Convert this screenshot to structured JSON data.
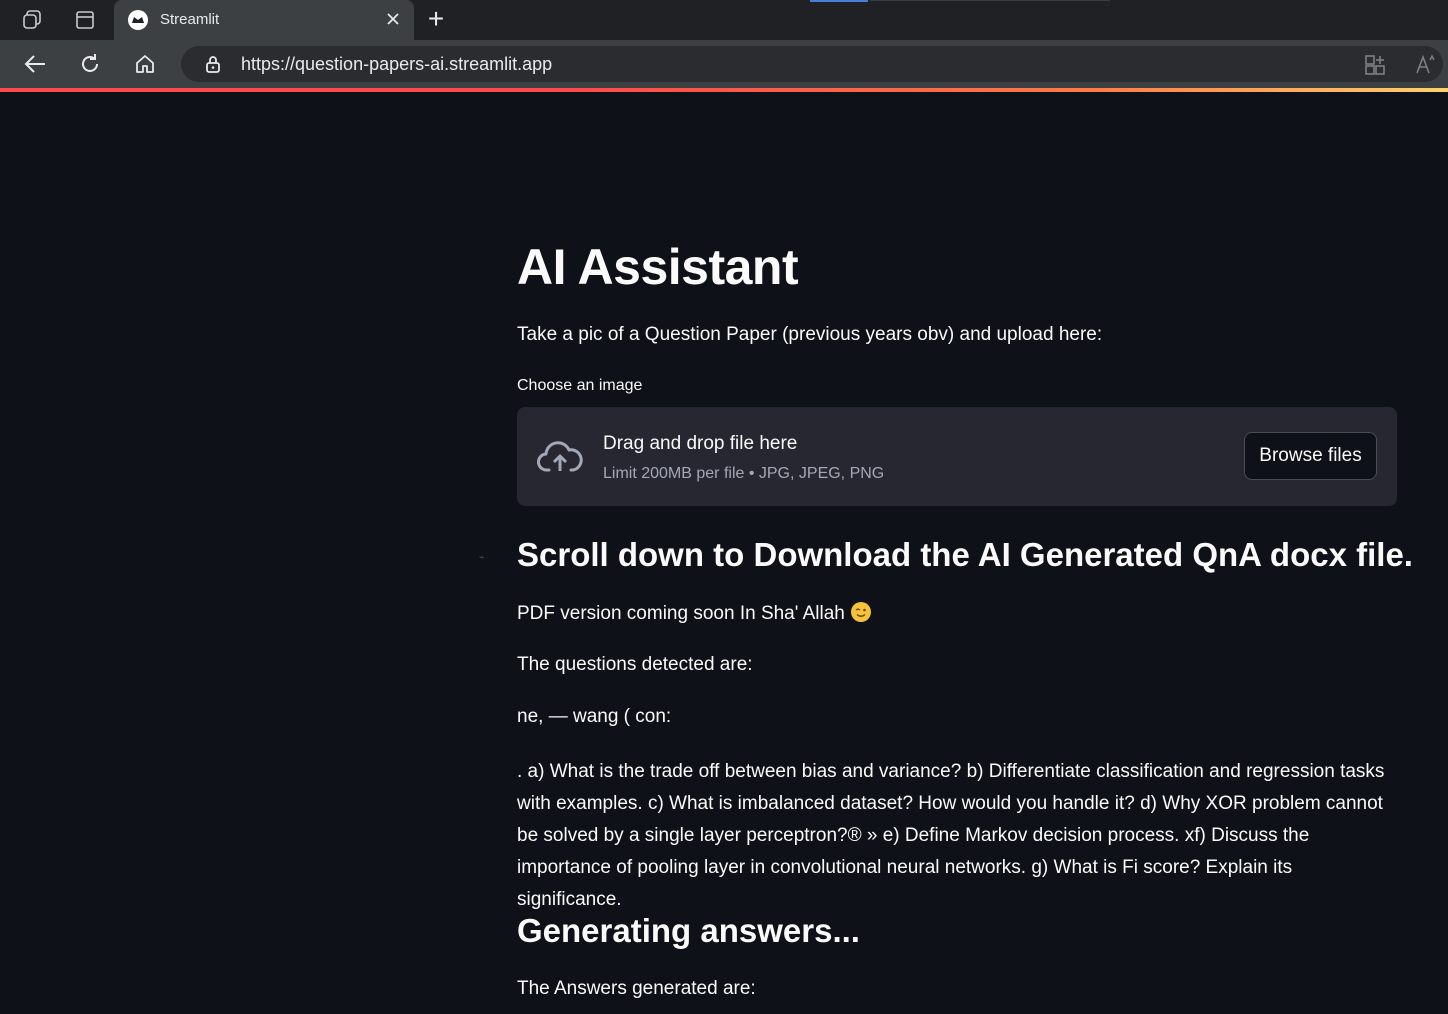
{
  "browser": {
    "tab_title": "Streamlit",
    "url": "https://question-papers-ai.streamlit.app"
  },
  "app": {
    "title": "AI Assistant",
    "intro": "Take a pic of a Question Paper (previous years obv) and upload here:",
    "uploader": {
      "label": "Choose an image",
      "drop_title": "Drag and drop file here",
      "drop_subtitle": "Limit 200MB per file • JPG, JPEG, PNG",
      "browse_label": "Browse files"
    },
    "download_heading": "Scroll down to Download the AI Generated QnA docx file.",
    "pdf_note": "PDF version coming soon In Sha' Allah",
    "questions_label": "The questions detected are:",
    "ocr_header": "ne, — wang ( con:",
    "questions_text": ". a) What is the trade off between bias and variance? b) Differentiate classification and regression tasks with examples. c) What is imbalanced dataset? How would you handle it? d) Why XOR problem cannot be solved by a single layer perceptron?® » e) Define Markov decision process. xf) Discuss the importance of pooling layer in convolutional neural networks. g) What is Fi score? Explain its significance.",
    "generating_heading": "Generating answers...",
    "answers_label": "The Answers generated are:"
  },
  "colors": {
    "background": "#0e1117",
    "uploader_bg": "#262730",
    "text": "#fafafa",
    "muted": "#a3a8b8",
    "accent": "#ff4b4b"
  }
}
